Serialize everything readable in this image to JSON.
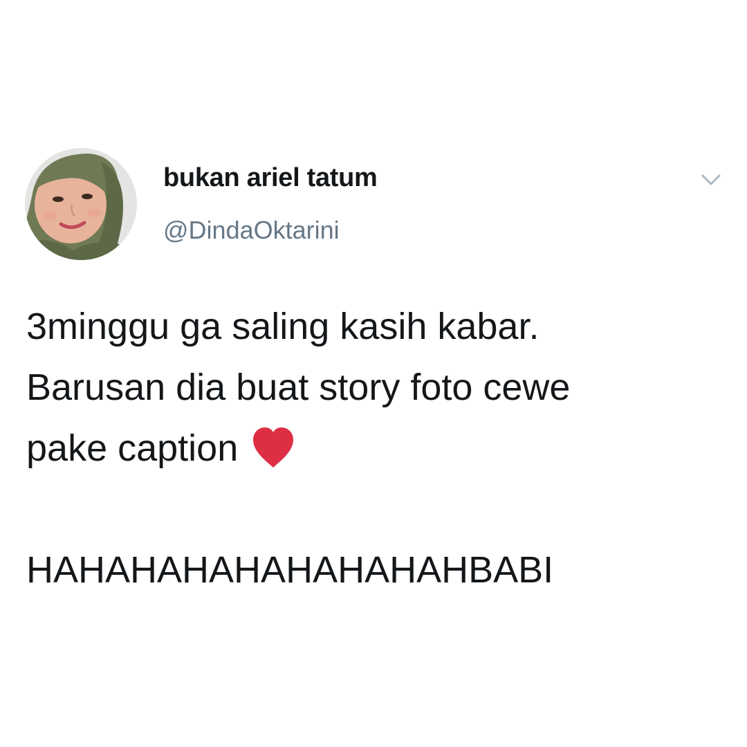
{
  "tweet": {
    "author": {
      "display_name": "bukan ariel tatum",
      "handle": "@DindaOktarini",
      "avatar_icon": "profile-photo"
    },
    "menu_icon": "chevron-down-icon",
    "text_lines": [
      "3minggu ga saling kasih kabar.",
      "Barusan dia buat story foto cewe",
      "pake caption"
    ],
    "emoji": "red-heart",
    "punchline": "HAHAHAHAHAHAHAHAHBABI"
  },
  "colors": {
    "text_primary": "#14171a",
    "text_secondary": "#657786",
    "chevron": "#aab8c2",
    "heart": "#dd2e44",
    "background": "#ffffff"
  }
}
